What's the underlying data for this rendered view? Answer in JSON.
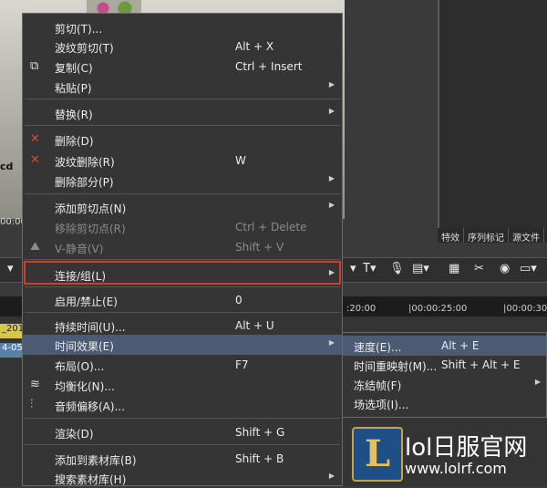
{
  "background": {
    "preview_text": "cd",
    "timecode_left": "00:00",
    "clip_yellow_label": "_201",
    "clip_blue_label": "4-05",
    "tabs": [
      "特效",
      "序列标记",
      "源文件"
    ],
    "ruler_ticks": [
      ":20:00",
      "|00:00:25:00",
      "|00:00:30"
    ]
  },
  "menu": {
    "items": [
      {
        "label": "剪切(T)...",
        "shortcut": "",
        "icon": "",
        "arrow": false,
        "disabled": false
      },
      {
        "label": "波纹剪切(T)",
        "shortcut": "Alt + X",
        "icon": "",
        "arrow": false,
        "disabled": false
      },
      {
        "label": "复制(C)",
        "shortcut": "Ctrl + Insert",
        "icon": "copy-icon",
        "arrow": false,
        "disabled": false
      },
      {
        "label": "粘贴(P)",
        "shortcut": "",
        "icon": "",
        "arrow": true,
        "disabled": false
      },
      {
        "label": "替换(R)",
        "shortcut": "",
        "icon": "",
        "arrow": true,
        "disabled": false
      },
      {
        "label": "删除(D)",
        "shortcut": "",
        "icon": "delete-icon",
        "arrow": false,
        "disabled": false
      },
      {
        "label": "波纹删除(R)",
        "shortcut": "W",
        "icon": "ripple-delete-icon",
        "arrow": false,
        "disabled": false
      },
      {
        "label": "删除部分(P)",
        "shortcut": "",
        "icon": "",
        "arrow": true,
        "disabled": false
      },
      {
        "label": "添加剪切点(N)",
        "shortcut": "",
        "icon": "",
        "arrow": true,
        "disabled": false
      },
      {
        "label": "移除剪切点(R)",
        "shortcut": "Ctrl + Delete",
        "icon": "",
        "arrow": false,
        "disabled": true
      },
      {
        "label": "V-静音(V)",
        "shortcut": "Shift + V",
        "icon": "mute-icon",
        "arrow": false,
        "disabled": true
      },
      {
        "label": "连接/组(L)",
        "shortcut": "",
        "icon": "",
        "arrow": true,
        "disabled": false
      },
      {
        "label": "启用/禁止(E)",
        "shortcut": "0",
        "icon": "",
        "arrow": false,
        "disabled": false
      },
      {
        "label": "持续时间(U)...",
        "shortcut": "Alt + U",
        "icon": "",
        "arrow": false,
        "disabled": false
      },
      {
        "label": "时间效果(E)",
        "shortcut": "",
        "icon": "",
        "arrow": true,
        "disabled": false
      },
      {
        "label": "布局(O)...",
        "shortcut": "F7",
        "icon": "",
        "arrow": false,
        "disabled": false
      },
      {
        "label": "均衡化(N)...",
        "shortcut": "",
        "icon": "equalize-icon",
        "arrow": false,
        "disabled": false
      },
      {
        "label": "音频偏移(A)...",
        "shortcut": "",
        "icon": "audio-offset-icon",
        "arrow": false,
        "disabled": false
      },
      {
        "label": "渲染(D)",
        "shortcut": "Shift + G",
        "icon": "",
        "arrow": false,
        "disabled": false
      },
      {
        "label": "添加到素材库(B)",
        "shortcut": "Shift + B",
        "icon": "",
        "arrow": false,
        "disabled": false
      },
      {
        "label": "搜索素材库(H)",
        "shortcut": "",
        "icon": "",
        "arrow": true,
        "disabled": false
      }
    ]
  },
  "submenu": {
    "items": [
      {
        "label": "速度(E)...",
        "shortcut": "Alt + E",
        "arrow": false
      },
      {
        "label": "时间重映射(M)...",
        "shortcut": "Shift + Alt + E",
        "arrow": false
      },
      {
        "label": "冻结帧(F)",
        "shortcut": "",
        "arrow": true
      },
      {
        "label": "场选项(I)...",
        "shortcut": "",
        "arrow": false
      }
    ]
  },
  "watermark": {
    "badge": "L",
    "title": "lol日服官网",
    "url": "www.lolrf.com"
  }
}
